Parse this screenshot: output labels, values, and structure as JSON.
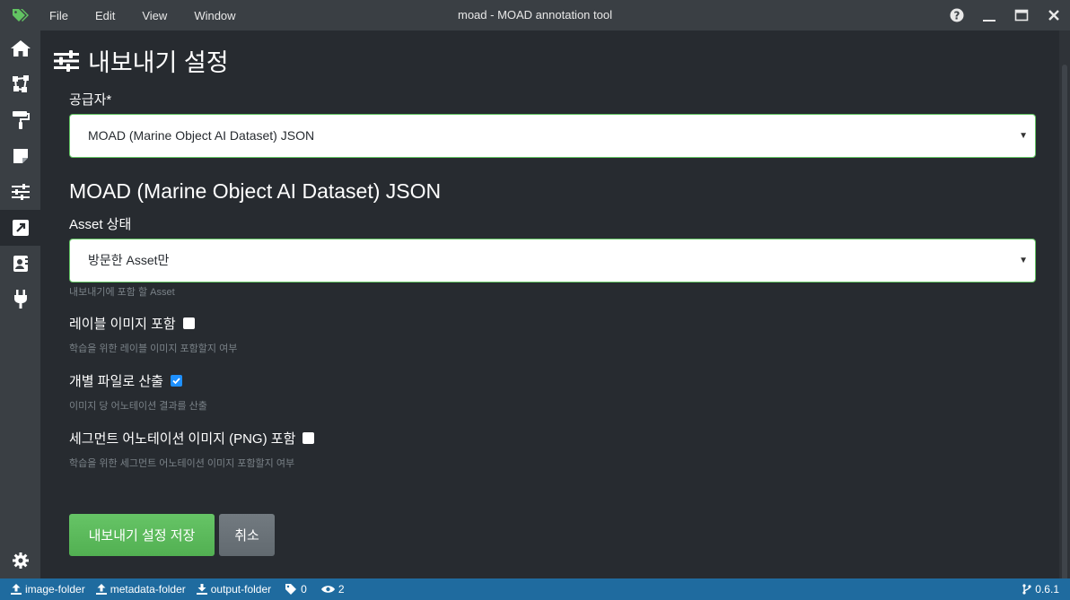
{
  "titlebar": {
    "menu": [
      "File",
      "Edit",
      "View",
      "Window"
    ],
    "title": "moad - MOAD annotation tool"
  },
  "icons": {
    "app": "tag-icon",
    "help": "question-circle-icon",
    "minimize": "minimize-icon",
    "maximize": "maximize-icon",
    "close": "close-icon"
  },
  "sidebar": {
    "items": [
      "home-icon",
      "vector-square-icon",
      "paint-roller-icon",
      "sticky-note-icon",
      "sliders-icon",
      "external-link-icon",
      "id-card-icon",
      "plug-icon"
    ],
    "active": "external-link-icon",
    "bottom": "gear-icon"
  },
  "page": {
    "title": "내보내기 설정",
    "provider_label": "공급자*",
    "provider_value": "MOAD (Marine Object AI Dataset) JSON",
    "section_title": "MOAD (Marine Object AI Dataset) JSON",
    "asset_label": "Asset 상태",
    "asset_value": "방문한 Asset만",
    "asset_help": "내보내기에 포함 할 Asset",
    "opt1_label": "레이블 이미지 포함",
    "opt1_checked": false,
    "opt1_help": "학습을 위한 레이블 이미지 포함할지 여부",
    "opt2_label": "개별 파일로 산출",
    "opt2_checked": true,
    "opt2_help": "이미지 당 어노테이션 결과를 산출",
    "opt3_label": "세그먼트 어노테이션 이미지 (PNG) 포함",
    "opt3_checked": false,
    "opt3_help": "학습을 위한 세그먼트 어노테이션 이미지 포함할지 여부",
    "save_label": "내보내기 설정 저장",
    "cancel_label": "취소"
  },
  "statusbar": {
    "source": "image-folder",
    "metadata": "metadata-folder",
    "output": "output-folder",
    "tags": "0",
    "visited": "2",
    "version": "0.6.1"
  },
  "colors": {
    "titlebar": "#3a3f44",
    "background": "#272b30",
    "statusbar": "#1f6b9f",
    "save_button": "#5cb85c",
    "cancel_button": "#6a7278",
    "accent_check": "#1e90ff",
    "logo": "#62c462"
  }
}
